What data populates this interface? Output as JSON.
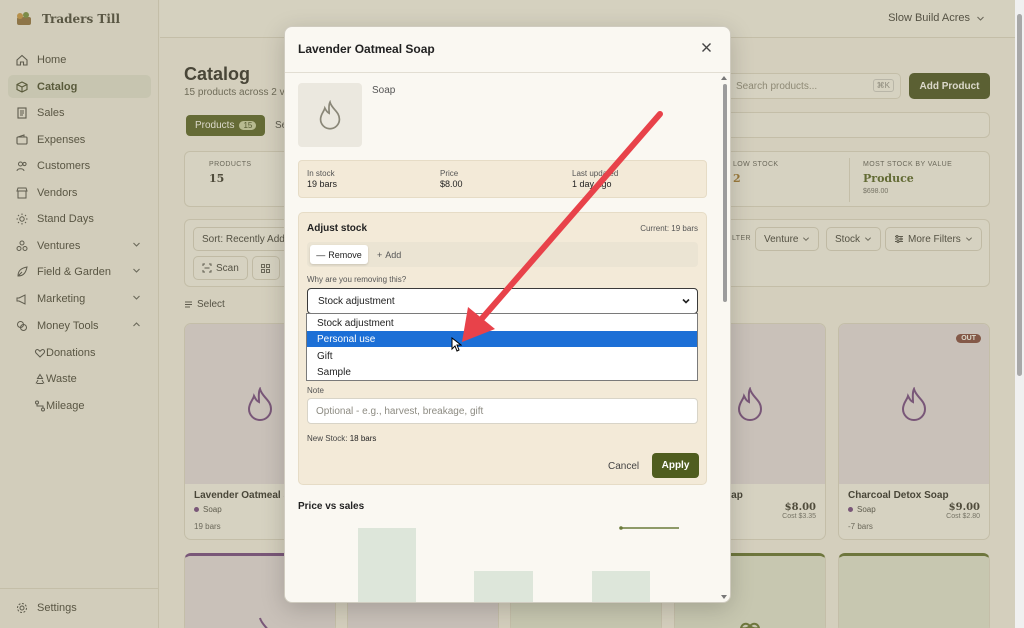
{
  "app": {
    "name": "Traders Till",
    "workspace": "Slow Build Acres"
  },
  "sidebar": {
    "items": [
      {
        "label": "Home",
        "icon": "home-icon"
      },
      {
        "label": "Catalog",
        "icon": "box-icon",
        "active": true
      },
      {
        "label": "Sales",
        "icon": "receipt-icon"
      },
      {
        "label": "Expenses",
        "icon": "wallet-icon"
      },
      {
        "label": "Customers",
        "icon": "users-icon"
      },
      {
        "label": "Vendors",
        "icon": "store-icon"
      },
      {
        "label": "Stand Days",
        "icon": "sun-icon"
      },
      {
        "label": "Ventures",
        "icon": "ventures-icon"
      },
      {
        "label": "Field & Garden",
        "icon": "leaf-icon"
      },
      {
        "label": "Marketing",
        "icon": "megaphone-icon"
      },
      {
        "label": "Money Tools",
        "icon": "coins-icon"
      }
    ],
    "subitems": [
      {
        "label": "Donations",
        "icon": "heart-hand-icon"
      },
      {
        "label": "Waste",
        "icon": "recycle-icon"
      },
      {
        "label": "Mileage",
        "icon": "route-icon"
      }
    ],
    "settings": "Settings"
  },
  "catalog": {
    "title": "Catalog",
    "subtitle": "15 products across 2 v",
    "tab_products": "Products",
    "tab_products_count": "15",
    "tab_partial": "Se",
    "search_placeholder": "Search products...",
    "search_kbd": "⌘K",
    "add_product": "Add Product",
    "stats": {
      "products_label": "PRODUCTS",
      "products_value": "15",
      "low_stock_label": "LOW STOCK",
      "low_stock_value": "2",
      "most_label": "MOST STOCK BY VALUE",
      "most_value": "Produce",
      "most_sub": "$698.00"
    },
    "sort_label": "Sort: Recently Add",
    "scan_label": "Scan",
    "filter_label": "LTER",
    "venture_label": "Venture",
    "stock_label": "Stock",
    "more_filters": "More Filters",
    "select_label": "Select",
    "cards": [
      {
        "title": "Lavender Oatmeal S",
        "type": "Soap",
        "stock": "19 bars"
      },
      {
        "title": "ppyseed Soap",
        "type": "",
        "stock": "",
        "price": "$8.00",
        "cost": "Cost $3.35"
      },
      {
        "title": "Charcoal Detox Soap",
        "type": "Soap",
        "stock": "-7 bars",
        "price": "$9.00",
        "cost": "Cost $2.80",
        "badge": "OUT"
      }
    ]
  },
  "modal": {
    "title": "Lavender Oatmeal Soap",
    "type": "Soap",
    "in_stock_label": "In stock",
    "in_stock_value": "19 bars",
    "price_label": "Price",
    "price_value": "$8.00",
    "last_updated_label": "Last updated",
    "last_updated_value": "1 day ago",
    "adjust_title": "Adjust stock",
    "current": "Current: 19 bars",
    "remove_label": "Remove",
    "add_label": "Add",
    "why_label": "Why are you removing this?",
    "select_value": "Stock adjustment",
    "options": [
      "Stock adjustment",
      "Personal use",
      "Gift",
      "Sample"
    ],
    "selected_option": "Personal use",
    "note_label": "Note",
    "note_placeholder": "Optional - e.g., harvest, breakage, gift",
    "new_stock_label": "New Stock:",
    "new_stock_value": "18 bars",
    "cancel": "Cancel",
    "apply": "Apply",
    "chart_title": "Price vs sales"
  },
  "colors": {
    "accent": "#4f5d1f",
    "highlight": "#1c6fd6",
    "arrow": "#e8424a",
    "plum": "#6b3c83"
  }
}
